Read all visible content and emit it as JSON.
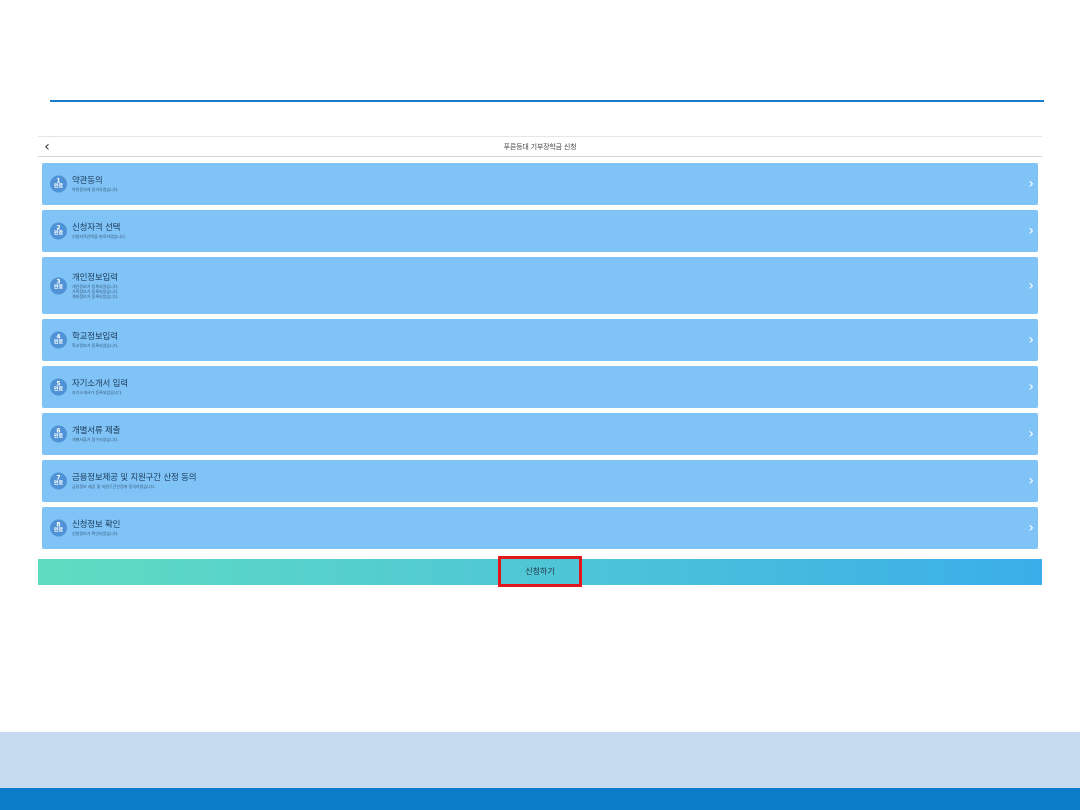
{
  "header": {
    "back_icon": "chevron-left-icon",
    "title": "푸른등대 기부장학금 신청"
  },
  "steps": [
    {
      "num": "1",
      "state": "완료",
      "title": "약관동의",
      "desc": [
        "약관동의에 동의하였습니다."
      ]
    },
    {
      "num": "2",
      "state": "완료",
      "title": "신청자격 선택",
      "desc": [
        "신청자격선택을 완료하였습니다."
      ]
    },
    {
      "num": "3",
      "state": "완료",
      "title": "개인정보입력",
      "desc": [
        "개인정보가 등록되었습니다.",
        "가족정보가 등록되었습니다.",
        "계좌정보가 등록되었습니다."
      ]
    },
    {
      "num": "4",
      "state": "완료",
      "title": "학교정보입력",
      "desc": [
        "학교정보가 등록되었습니다."
      ]
    },
    {
      "num": "5",
      "state": "완료",
      "title": "자기소개서 입력",
      "desc": [
        "자기소개서가 등록되었습니다."
      ]
    },
    {
      "num": "6",
      "state": "완료",
      "title": "개별서류 제출",
      "desc": [
        "개별서류가 접수되었습니다."
      ]
    },
    {
      "num": "7",
      "state": "완료",
      "title": "금융정보제공 및 지원구간 산정 동의",
      "desc": [
        "금융정보 제공 및 지원구간산정에 동의하였습니다."
      ]
    },
    {
      "num": "8",
      "state": "완료",
      "title": "신청정보 확인",
      "desc": [
        "신청정보가 확인되었습니다."
      ]
    }
  ],
  "apply": {
    "label": "신청하기",
    "highlight_color": "#e3161c"
  },
  "colors": {
    "step_bg": "#7fc3f7",
    "badge_bg": "#4f93d6",
    "top_rule": "#1a7cc9",
    "footer_light": "#c6daf0",
    "footer_dark": "#0a7cc8"
  }
}
